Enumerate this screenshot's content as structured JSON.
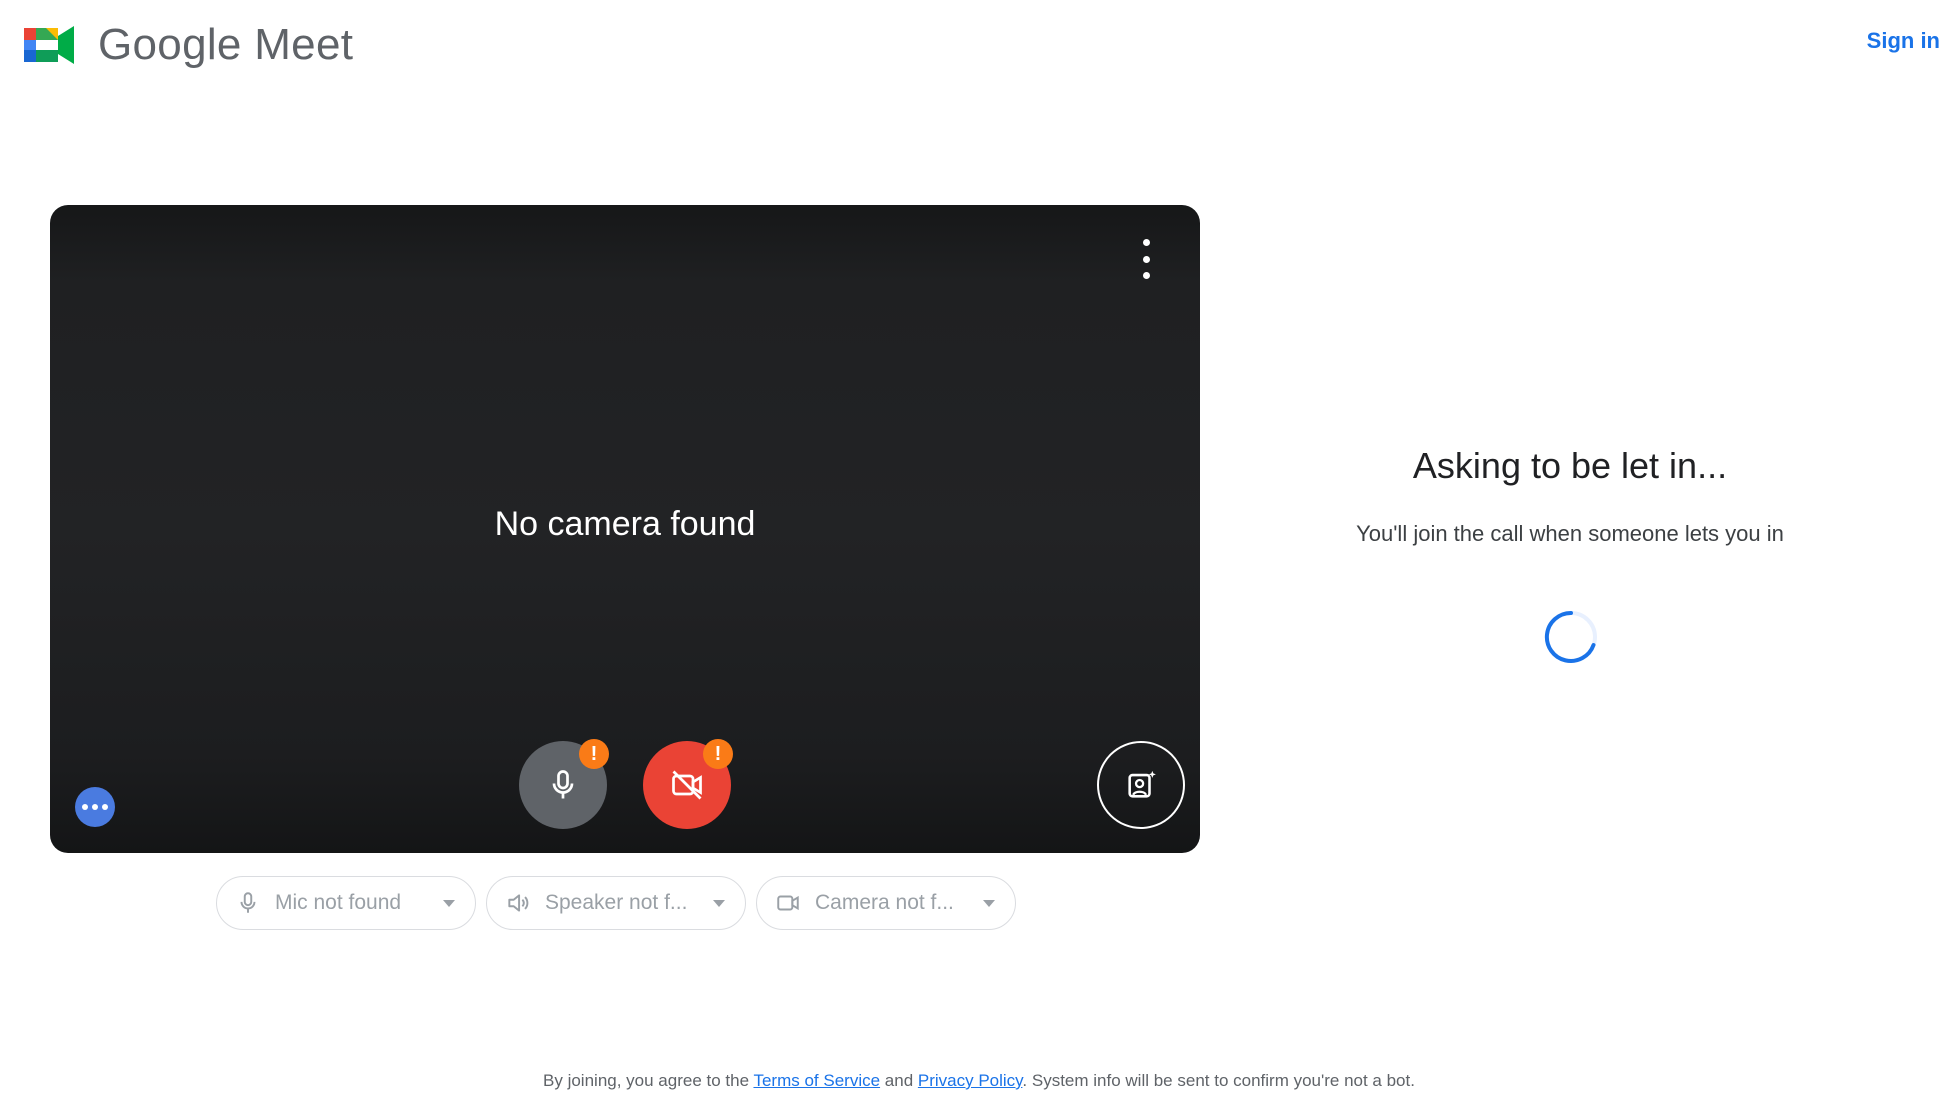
{
  "header": {
    "app_name_google": "Google",
    "app_name_meet": "Meet",
    "sign_in": "Sign in"
  },
  "preview": {
    "status_text": "No camera found",
    "mic_warning": "!",
    "camera_warning": "!",
    "icons": {
      "menu": "more-vert-icon",
      "mic": "microphone-icon",
      "camera": "camera-off-icon",
      "effects": "visual-effects-icon",
      "more": "more-horiz-icon"
    }
  },
  "devices": {
    "mic_label": "Mic not found",
    "speaker_label": "Speaker not f...",
    "camera_label": "Camera not f..."
  },
  "waiting": {
    "title": "Asking to be let in...",
    "subtitle": "You'll join the call when someone lets you in"
  },
  "footer": {
    "text_before": "By joining, you agree to the ",
    "terms_link": "Terms of Service",
    "text_and": " and ",
    "privacy_link": "Privacy Policy",
    "text_after": ". System info will be sent to confirm you're not a bot."
  },
  "colors": {
    "brand_blue": "#1a73e8",
    "camera_off_red": "#ea4335",
    "warning_orange": "#fa7b17",
    "mic_gray": "#5f6368",
    "preview_bg": "#222325"
  }
}
